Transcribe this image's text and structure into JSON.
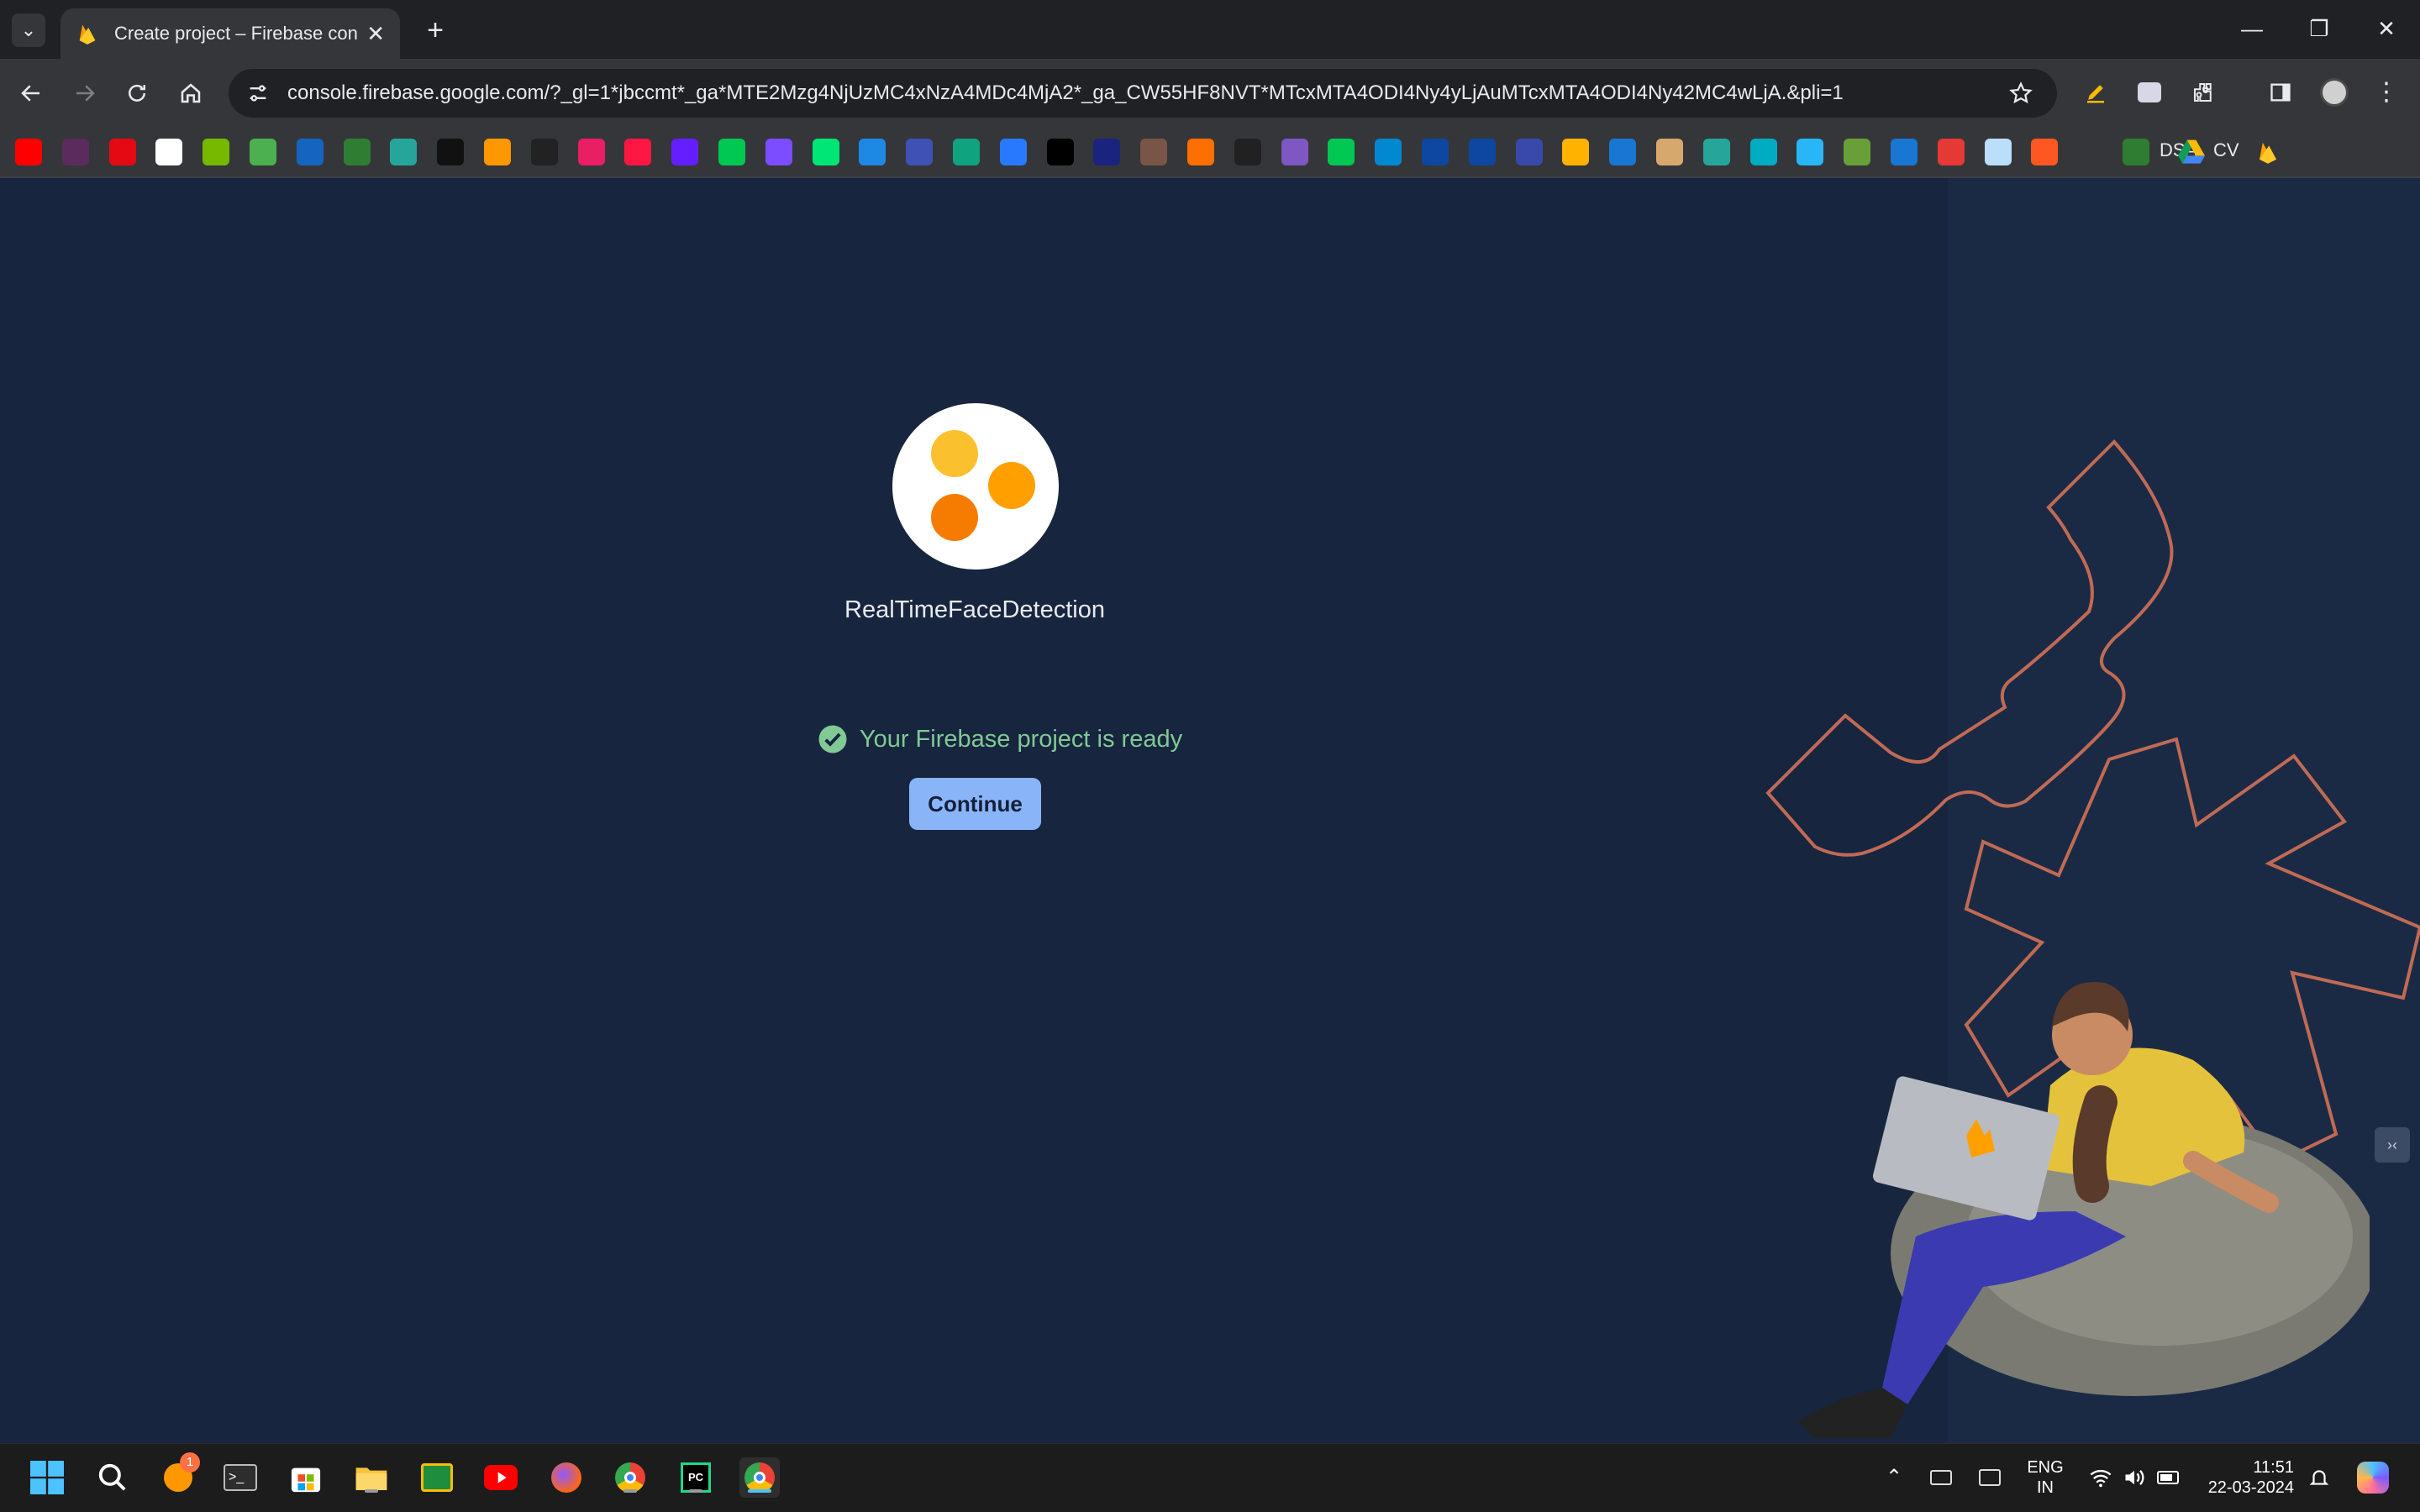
{
  "browser": {
    "tab_title": "Create project – Firebase console",
    "tab_close": "✕",
    "new_tab": "+",
    "url": "console.firebase.google.com/?_gl=1*jbccmt*_ga*MTE2Mzg4NjUzMC4xNzA4MDc4MjA2*_ga_CW55HF8NVT*MTcxMTA4ODI4Ny4yLjAuMTcxMTA4ODI4Ny42MC4wLjA.&pli=1",
    "window_controls": {
      "minimize": "—",
      "restore": "❐",
      "close": "✕"
    }
  },
  "bookmarks": {
    "labeled": [
      {
        "label": "DSA",
        "color": "#2e7d32"
      },
      {
        "label": "CV",
        "color": "#fbbc04"
      }
    ],
    "icon_colors": [
      "#ff0000",
      "#5b2b5e",
      "#e50914",
      "#ffffff",
      "#76b900",
      "#4caf50",
      "#1565c0",
      "#2e7d32",
      "#26a69a",
      "#111111",
      "#ff9800",
      "#222222",
      "#e91e63",
      "#ff1744",
      "#651fff",
      "#00c853",
      "#7c4dff",
      "#00e676",
      "#1e88e5",
      "#3f51b5",
      "#10a37f",
      "#2979ff",
      "#000000",
      "#1a237e",
      "#795548",
      "#ff6f00",
      "#212121",
      "#7e57c2",
      "#00c853",
      "#0288d1",
      "#0d47a1",
      "#0d47a1",
      "#3949ab",
      "#ffb300",
      "#1976d2",
      "#d7a86e",
      "#26a69a",
      "#00acc1",
      "#29b6f6",
      "#689f38",
      "#1976d2",
      "#e53935",
      "#bbdefb",
      "#ff5722"
    ]
  },
  "project": {
    "name": "RealTimeFaceDetection",
    "status_text": "Your Firebase project is ready",
    "continue_label": "Continue",
    "dot_colors": [
      "#fbc02d",
      "#ffa000",
      "#f57c00"
    ]
  },
  "panel_toggle": "›‹",
  "taskbar": {
    "notification_badge": "1",
    "lang_top": "ENG",
    "lang_bottom": "IN",
    "time": "11:51",
    "date": "22-03-2024"
  }
}
